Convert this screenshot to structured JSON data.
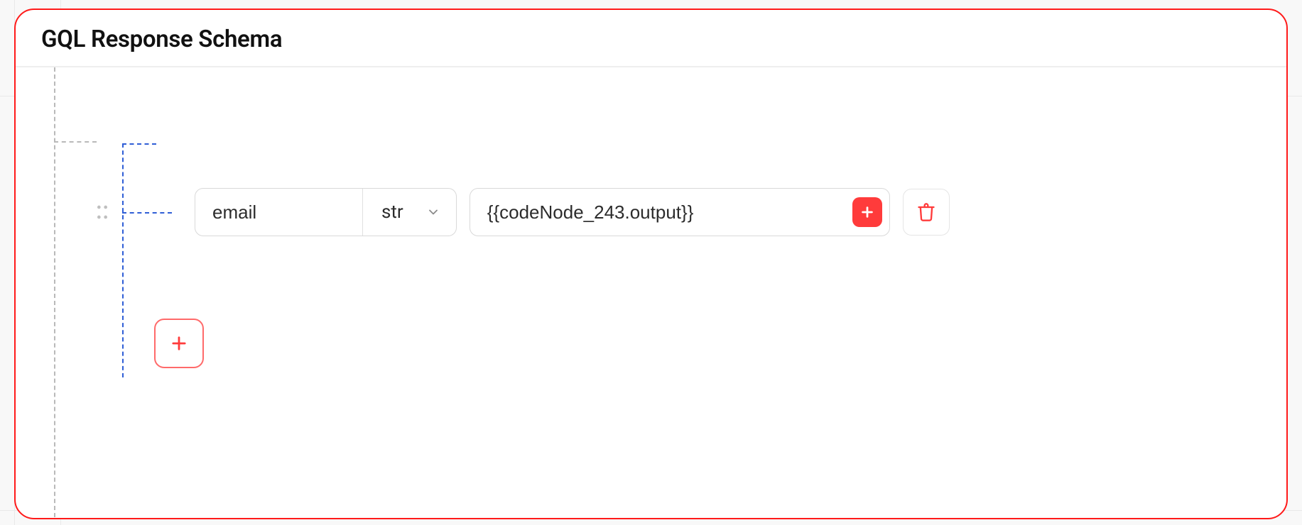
{
  "panel": {
    "title": "GQL Response Schema"
  },
  "schema": {
    "fields": [
      {
        "name": "email",
        "type_label": "str",
        "value_expr": "{{codeNode_243.output}}"
      }
    ]
  },
  "icons": {
    "drag": "drag-handle",
    "chevron_down": "chevron-down",
    "plus": "plus",
    "trash": "trash"
  },
  "colors": {
    "panel_border": "#ff1a1a",
    "accent_red": "#ff3b3b",
    "tree_gray": "#b9b9b9",
    "tree_blue": "#2f5ed6",
    "field_border": "#d9d9d9"
  }
}
